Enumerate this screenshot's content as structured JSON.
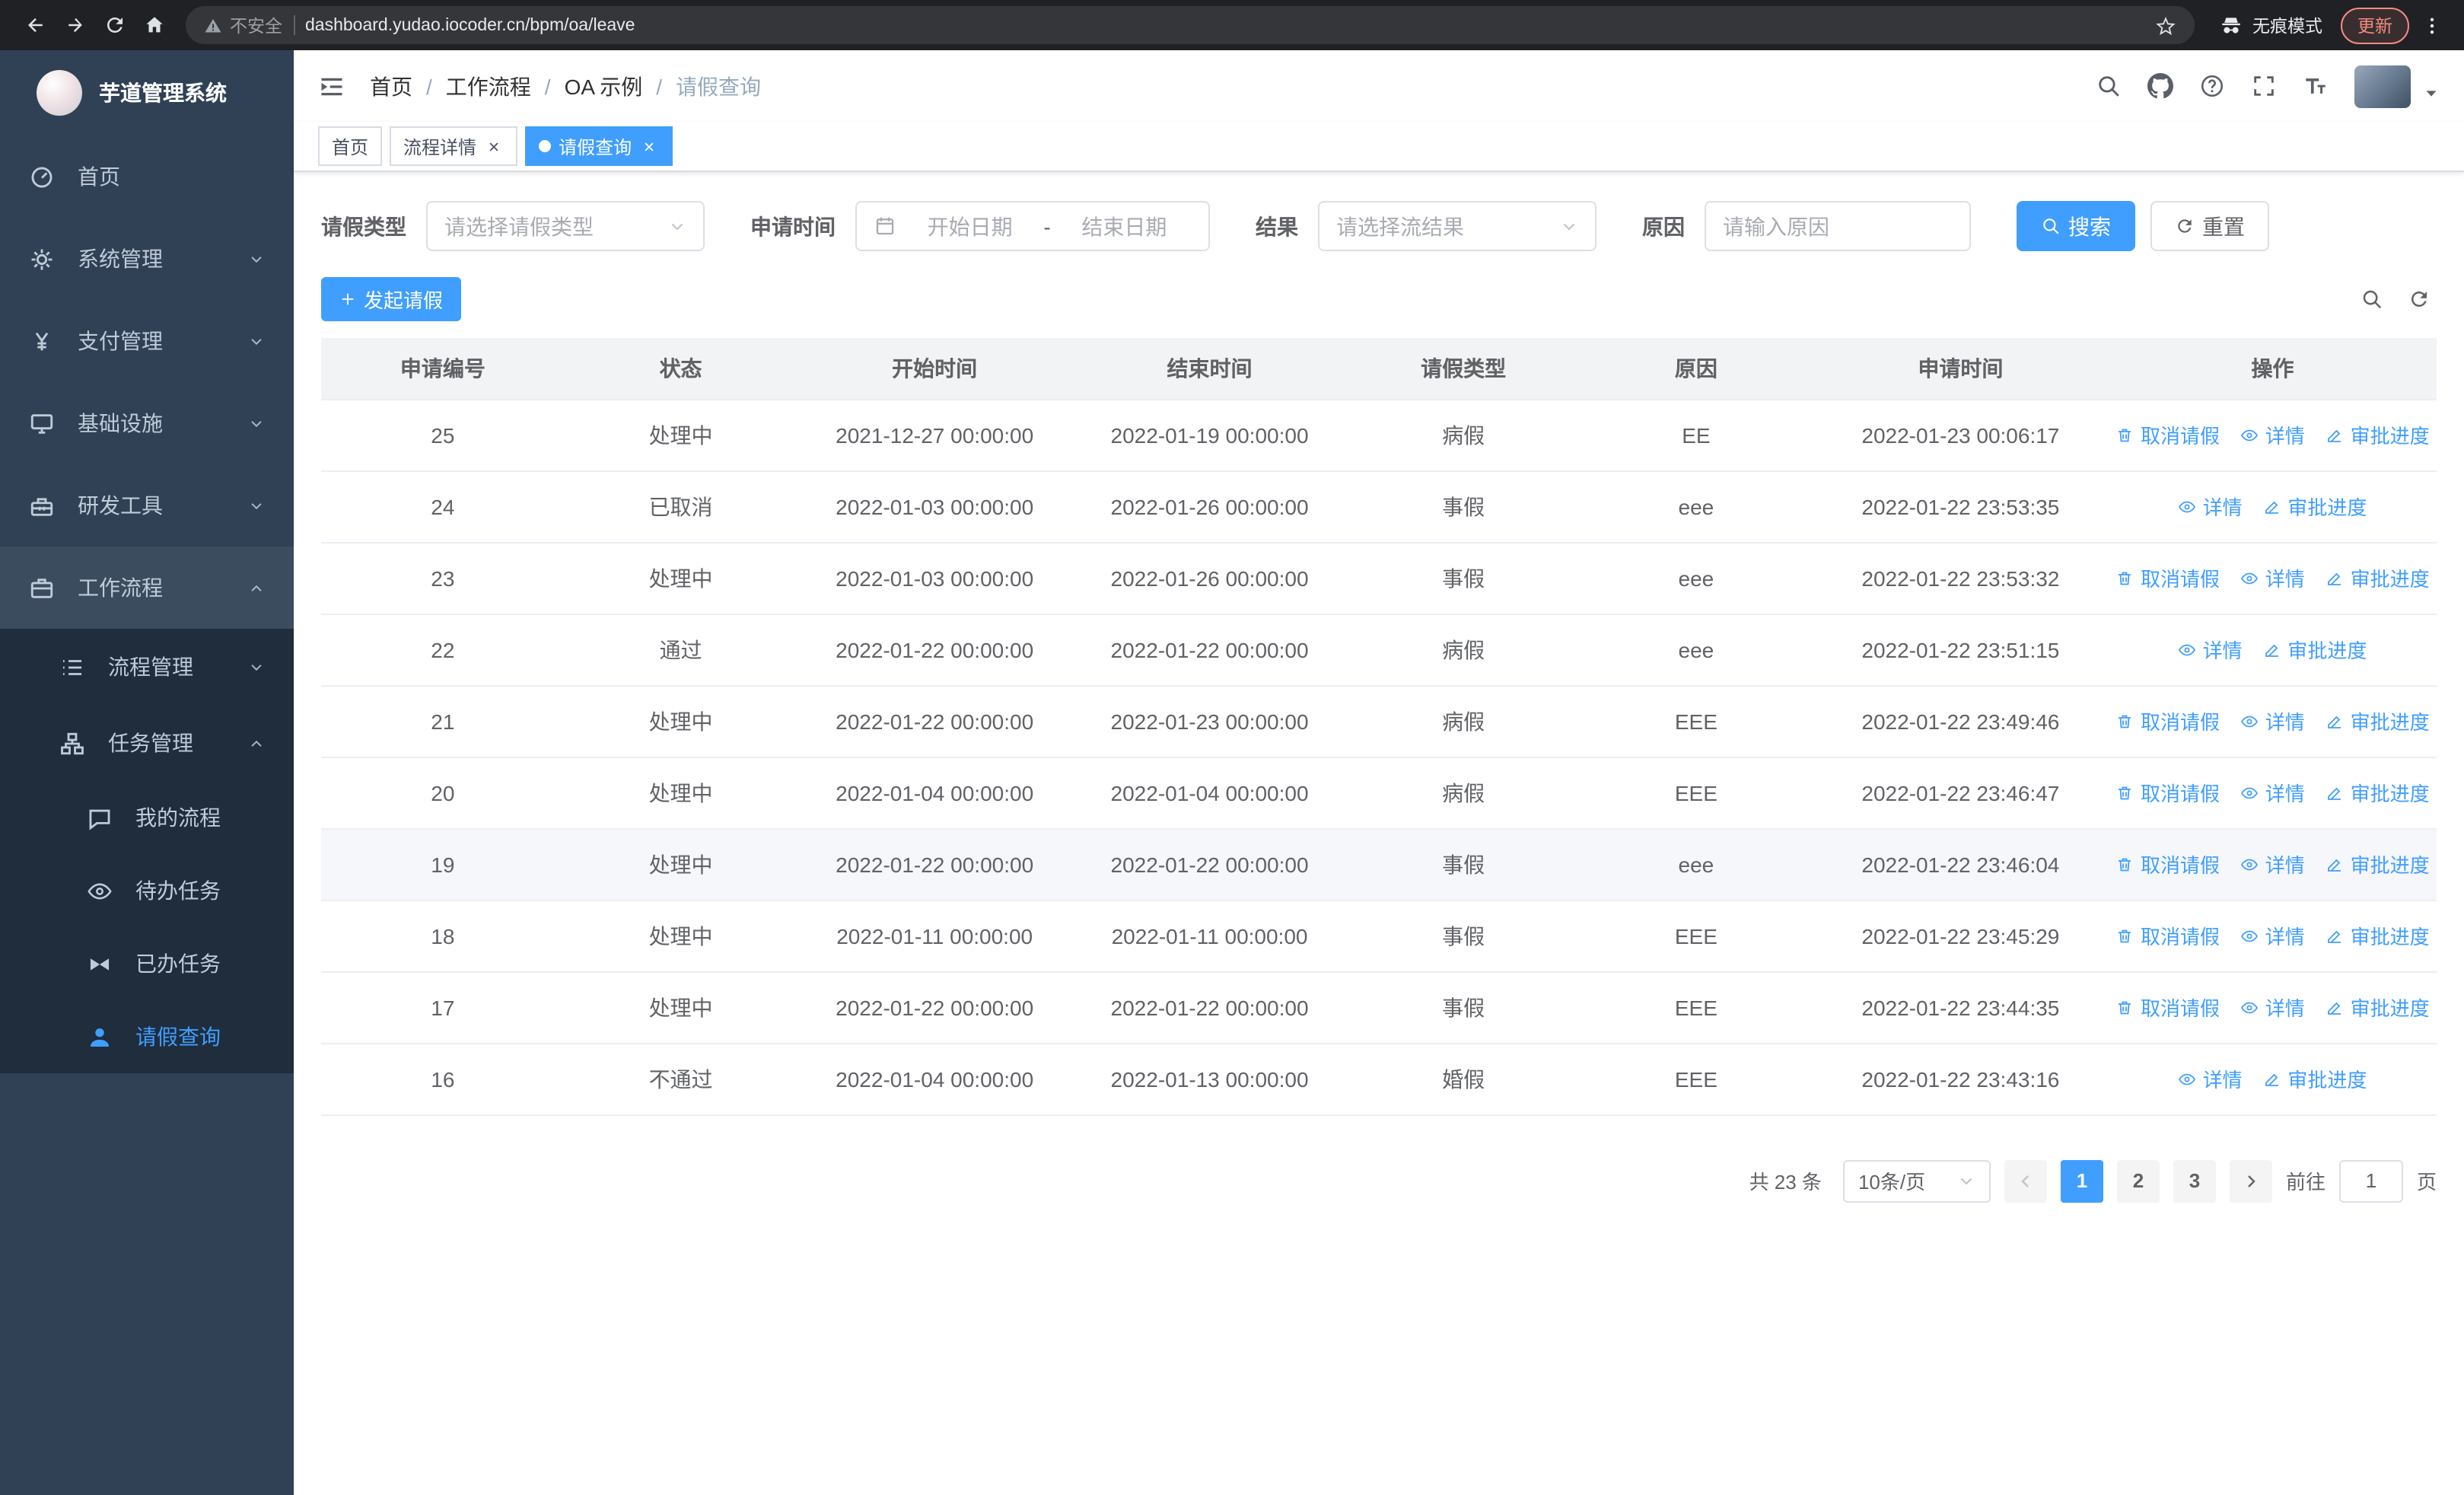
{
  "colors": {
    "primary": "#409eff",
    "sidebar_bg": "#304156",
    "sidebar_submenu_bg": "#1f2d3d",
    "sidebar_text": "#bfcbd9",
    "table_header_bg": "#f2f3f5",
    "update_badge": "#f28b82"
  },
  "browser": {
    "security_label": "不安全",
    "url": "dashboard.yudao.iocoder.cn/bpm/oa/leave",
    "incognito_label": "无痕模式",
    "update_label": "更新"
  },
  "sidebar": {
    "title": "芋道管理系统",
    "items": {
      "home": "首页",
      "system": "系统管理",
      "payment": "支付管理",
      "infra": "基础设施",
      "devtools": "研发工具",
      "workflow": "工作流程",
      "process_mgmt": "流程管理",
      "task_mgmt": "任务管理",
      "my_process": "我的流程",
      "todo_task": "待办任务",
      "done_task": "已办任务",
      "leave_query": "请假查询"
    }
  },
  "breadcrumb": [
    "首页",
    "工作流程",
    "OA 示例",
    "请假查询"
  ],
  "breadcrumb_separator": "/",
  "tabs": [
    {
      "label": "首页"
    },
    {
      "label": "流程详情"
    },
    {
      "label": "请假查询"
    }
  ],
  "filters": {
    "leave_type": {
      "label": "请假类型",
      "placeholder": "请选择请假类型"
    },
    "apply_time": {
      "label": "申请时间",
      "start_placeholder": "开始日期",
      "separator": "-",
      "end_placeholder": "结束日期"
    },
    "result": {
      "label": "结果",
      "placeholder": "请选择流结果"
    },
    "reason": {
      "label": "原因",
      "placeholder": "请输入原因"
    },
    "search_label": "搜索",
    "reset_label": "重置"
  },
  "toolbar": {
    "create_label": "发起请假"
  },
  "table": {
    "columns": [
      "申请编号",
      "状态",
      "开始时间",
      "结束时间",
      "请假类型",
      "原因",
      "申请时间",
      "操作"
    ],
    "action_labels": {
      "cancel": "取消请假",
      "detail": "详情",
      "progress": "审批进度"
    },
    "rows": [
      {
        "id": "25",
        "status": "处理中",
        "start_time": "2021-12-27 00:00:00",
        "end_time": "2022-01-19 00:00:00",
        "leave_type": "病假",
        "reason": "EE",
        "apply_time": "2022-01-23 00:06:17",
        "can_cancel": true,
        "highlighted": false
      },
      {
        "id": "24",
        "status": "已取消",
        "start_time": "2022-01-03 00:00:00",
        "end_time": "2022-01-26 00:00:00",
        "leave_type": "事假",
        "reason": "eee",
        "apply_time": "2022-01-22 23:53:35",
        "can_cancel": false,
        "highlighted": false
      },
      {
        "id": "23",
        "status": "处理中",
        "start_time": "2022-01-03 00:00:00",
        "end_time": "2022-01-26 00:00:00",
        "leave_type": "事假",
        "reason": "eee",
        "apply_time": "2022-01-22 23:53:32",
        "can_cancel": true,
        "highlighted": false
      },
      {
        "id": "22",
        "status": "通过",
        "start_time": "2022-01-22 00:00:00",
        "end_time": "2022-01-22 00:00:00",
        "leave_type": "病假",
        "reason": "eee",
        "apply_time": "2022-01-22 23:51:15",
        "can_cancel": false,
        "highlighted": false
      },
      {
        "id": "21",
        "status": "处理中",
        "start_time": "2022-01-22 00:00:00",
        "end_time": "2022-01-23 00:00:00",
        "leave_type": "病假",
        "reason": "EEE",
        "apply_time": "2022-01-22 23:49:46",
        "can_cancel": true,
        "highlighted": false
      },
      {
        "id": "20",
        "status": "处理中",
        "start_time": "2022-01-04 00:00:00",
        "end_time": "2022-01-04 00:00:00",
        "leave_type": "病假",
        "reason": "EEE",
        "apply_time": "2022-01-22 23:46:47",
        "can_cancel": true,
        "highlighted": false
      },
      {
        "id": "19",
        "status": "处理中",
        "start_time": "2022-01-22 00:00:00",
        "end_time": "2022-01-22 00:00:00",
        "leave_type": "事假",
        "reason": "eee",
        "apply_time": "2022-01-22 23:46:04",
        "can_cancel": true,
        "highlighted": true
      },
      {
        "id": "18",
        "status": "处理中",
        "start_time": "2022-01-11 00:00:00",
        "end_time": "2022-01-11 00:00:00",
        "leave_type": "事假",
        "reason": "EEE",
        "apply_time": "2022-01-22 23:45:29",
        "can_cancel": true,
        "highlighted": false
      },
      {
        "id": "17",
        "status": "处理中",
        "start_time": "2022-01-22 00:00:00",
        "end_time": "2022-01-22 00:00:00",
        "leave_type": "事假",
        "reason": "EEE",
        "apply_time": "2022-01-22 23:44:35",
        "can_cancel": true,
        "highlighted": false
      },
      {
        "id": "16",
        "status": "不通过",
        "start_time": "2022-01-04 00:00:00",
        "end_time": "2022-01-13 00:00:00",
        "leave_type": "婚假",
        "reason": "EEE",
        "apply_time": "2022-01-22 23:43:16",
        "can_cancel": false,
        "highlighted": false
      }
    ]
  },
  "pagination": {
    "total_label": "共 23 条",
    "page_size_label": "10条/页",
    "pages": [
      "1",
      "2",
      "3"
    ],
    "active_page": "1",
    "goto_label": "前往",
    "goto_value": "1",
    "goto_unit": "页"
  }
}
